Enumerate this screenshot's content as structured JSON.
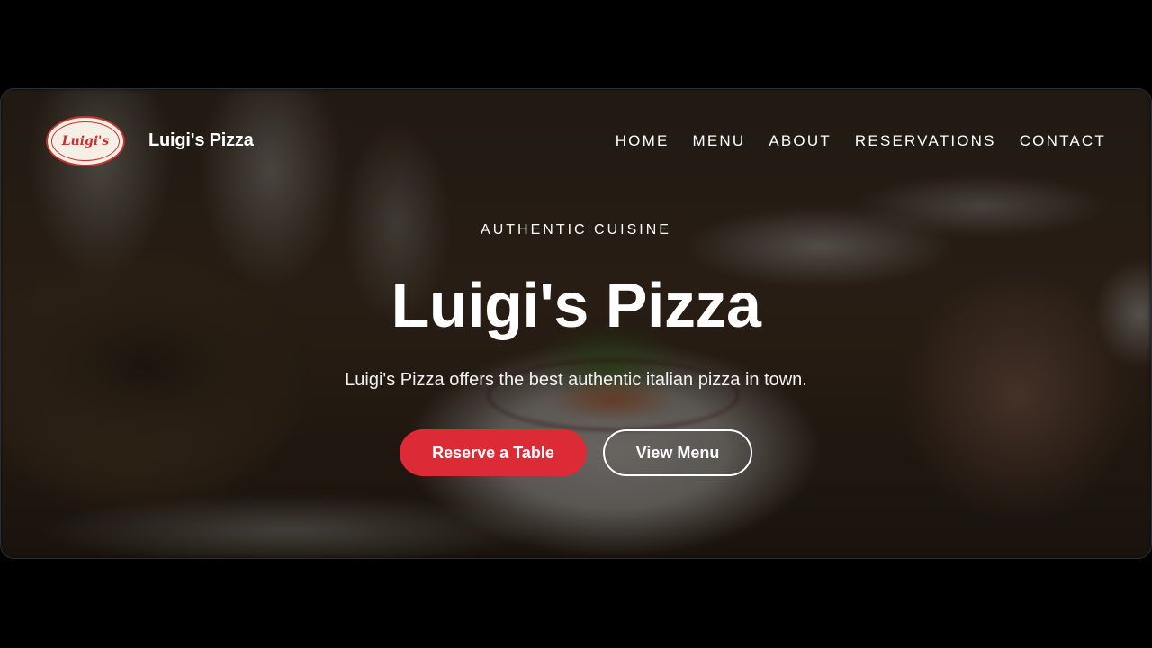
{
  "navbar": {
    "logo_text": "Luigi's",
    "brand": "Luigi's Pizza",
    "links": [
      {
        "label": "HOME"
      },
      {
        "label": "MENU"
      },
      {
        "label": "ABOUT"
      },
      {
        "label": "RESERVATIONS"
      },
      {
        "label": "CONTACT"
      }
    ]
  },
  "hero": {
    "eyebrow": "AUTHENTIC CUISINE",
    "title": "Luigi's Pizza",
    "subtitle": "Luigi's Pizza offers the best authentic italian pizza in town.",
    "primary_button": "Reserve a Table",
    "secondary_button": "View Menu"
  },
  "colors": {
    "accent": "#dc2a36",
    "logo_red": "#c7322d",
    "text": "#ffffff"
  }
}
